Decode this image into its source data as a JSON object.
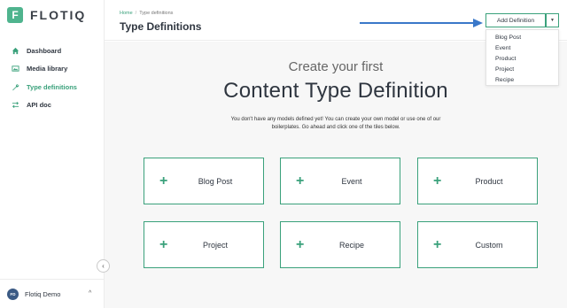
{
  "brand": {
    "logo_letter": "F",
    "name": "FLOTIQ",
    "color": "#4fb48e"
  },
  "sidebar": {
    "items": [
      {
        "label": "Dashboard",
        "icon": "home-icon",
        "active": false
      },
      {
        "label": "Media library",
        "icon": "image-icon",
        "active": false
      },
      {
        "label": "Type definitions",
        "icon": "wrench-icon",
        "active": true
      },
      {
        "label": "API doc",
        "icon": "swap-icon",
        "active": false
      }
    ],
    "collapse_glyph": "‹"
  },
  "user": {
    "initials": "FD",
    "name": "Flotiq Demo",
    "chevron": "^"
  },
  "header": {
    "breadcrumb": {
      "home": "Home",
      "separator": "/",
      "current": "Type definitions"
    },
    "title": "Type Definitions"
  },
  "add_definition": {
    "label": "Add Definition",
    "caret": "▼",
    "options": [
      "Blog Post",
      "Event",
      "Product",
      "Project",
      "Recipe"
    ]
  },
  "hero": {
    "subtitle": "Create your first",
    "title": "Content Type Definition",
    "description_line1": "You don't have any models defined yet! You can create your own model or use one of our",
    "description_line2": "boilerplates. Go ahead and click one of the tiles below."
  },
  "tiles": [
    "Blog Post",
    "Event",
    "Product",
    "Project",
    "Recipe",
    "Custom"
  ],
  "colors": {
    "accent": "#3aa17b",
    "arrow": "#3a78c9",
    "avatar": "#3b5a84"
  }
}
